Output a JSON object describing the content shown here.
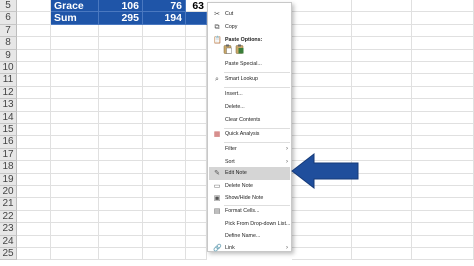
{
  "rows": [
    "5",
    "6",
    "7",
    "8",
    "9",
    "10",
    "11",
    "12",
    "13",
    "14",
    "15",
    "16",
    "17",
    "18",
    "19",
    "20",
    "21",
    "22",
    "23",
    "24",
    "25"
  ],
  "table": {
    "row5": {
      "name": "Grace",
      "v1": "106",
      "v2": "76",
      "v3": "63"
    },
    "row6": {
      "name": "Sum",
      "v1": "295",
      "v2": "194"
    }
  },
  "menu": {
    "cut": "Cut",
    "copy": "Copy",
    "paste_options": "Paste Options:",
    "paste_special": "Paste Special...",
    "smart_lookup": "Smart Lookup",
    "insert": "Insert...",
    "delete": "Delete...",
    "clear_contents": "Clear Contents",
    "quick_analysis": "Quick Analysis",
    "filter": "Filter",
    "sort": "Sort",
    "edit_note": "Edit Note",
    "delete_note": "Delete Note",
    "show_hide_note": "Show/Hide Note",
    "format_cells": "Format Cells...",
    "pick_from_list": "Pick From Drop-down List...",
    "define_name": "Define Name...",
    "link": "Link"
  },
  "colors": {
    "selection": "#1f55a8",
    "arrow": "#1f4e9c",
    "highlight": "#d5d5d5"
  }
}
